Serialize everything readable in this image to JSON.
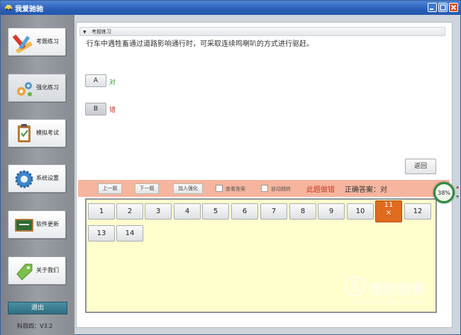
{
  "window": {
    "title": "我爱驰驰",
    "colors": {
      "titlebar": "#2a5fb8",
      "close": "#d8522c"
    }
  },
  "sidebar": {
    "items": [
      {
        "label": "考题练习",
        "icon": "pencil-ruler-icon"
      },
      {
        "label": "强化练习",
        "icon": "gears-icon"
      },
      {
        "label": "模拟考试",
        "icon": "clipboard-icon"
      },
      {
        "label": "系统设置",
        "icon": "gear-icon"
      },
      {
        "label": "软件更新",
        "icon": "chalkboard-icon"
      },
      {
        "label": "关于我们",
        "icon": "tag-icon"
      }
    ],
    "active_index": 1,
    "exit_label": "退出",
    "version": "科目四：V3.2"
  },
  "main": {
    "panel_title": "考题练习",
    "question": "行车中遇牲畜通过道路影响通行时，可采取连续鸣喇叭的方式进行驱赶。",
    "options": [
      {
        "key": "A",
        "text": "对",
        "color": "#2e9a2e"
      },
      {
        "key": "B",
        "text": "错",
        "color": "#c0392b"
      }
    ],
    "back_label": "返回"
  },
  "toolbar": {
    "prev_label": "上一题",
    "next_label": "下一题",
    "add_label": "加入强化",
    "show_answer_label": "查看答案",
    "auto_jump_label": "自动跳转",
    "wrong_text": "此题做错",
    "answer_text": "正确答案：对",
    "background": "#f5b59e"
  },
  "grid": {
    "numbers": [
      "1",
      "2",
      "3",
      "4",
      "5",
      "6",
      "7",
      "8",
      "9",
      "10",
      "11",
      "12",
      "13",
      "14"
    ],
    "current": "11",
    "current_mark": "×",
    "background": "#fffecd"
  },
  "progress": {
    "value": "38%",
    "fraction": 0.38
  },
  "watermark": {
    "text": "搜狗指南",
    "url": "zhinan.sogou.com"
  }
}
